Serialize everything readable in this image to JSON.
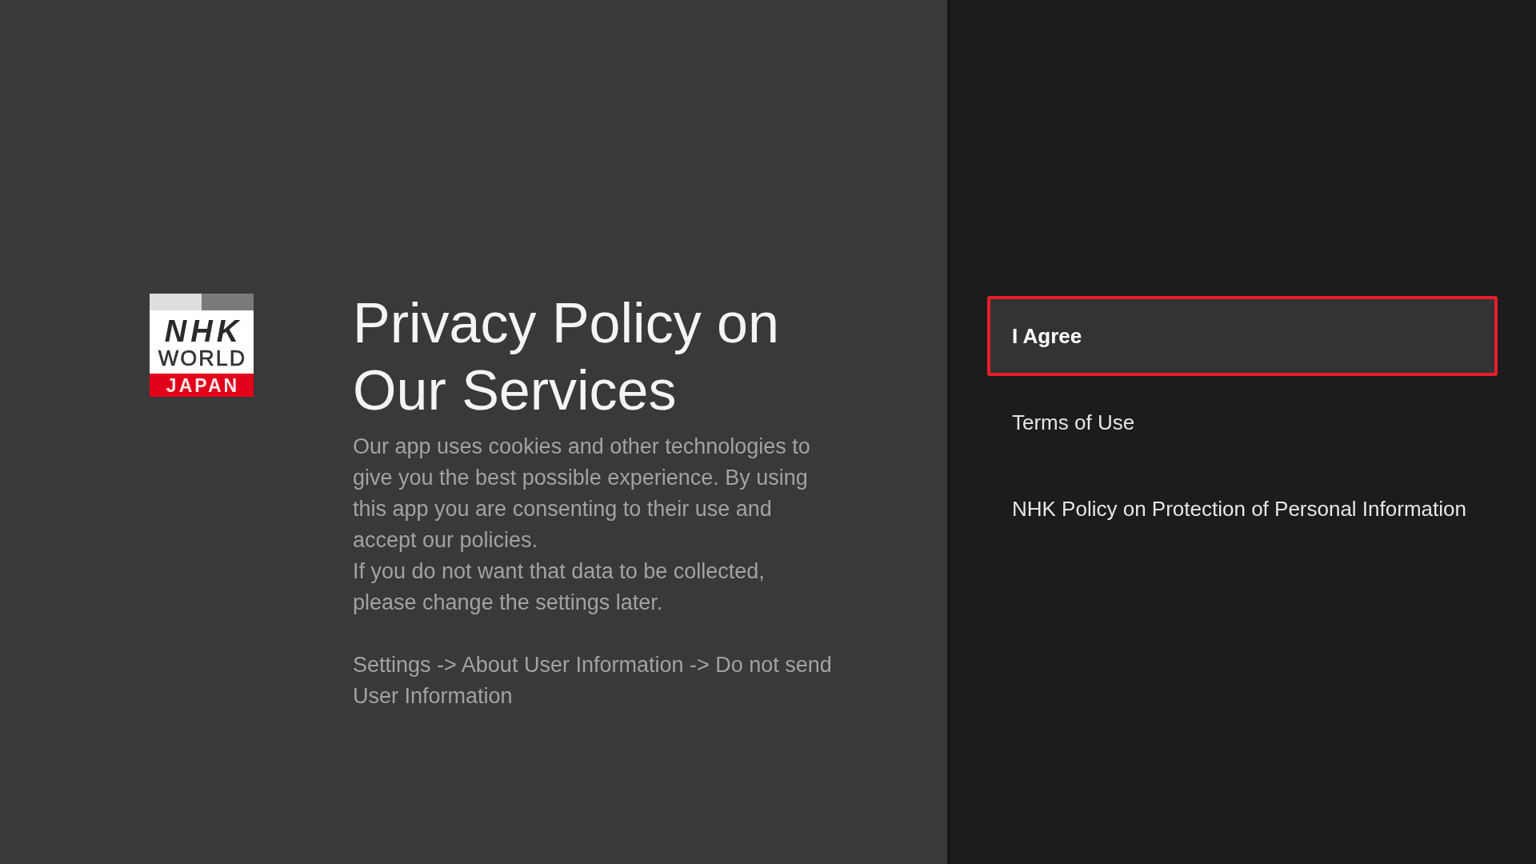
{
  "logo": [
    {
      "kind": "wordmark",
      "text": "NHK"
    },
    {
      "kind": "subline",
      "text": "WORLD"
    },
    {
      "kind": "band",
      "text": "JAPAN"
    }
  ],
  "title": "Privacy Policy on Our Services",
  "body": [
    {
      "kind": "paragraph",
      "text": "Our app uses cookies and other technologies to give you the best possible experience. By using this app you are consenting to their use and accept our policies."
    },
    {
      "kind": "paragraph",
      "text": "If you do not want that data to be collected, please change the settings later."
    },
    {
      "kind": "instruction",
      "text": "Settings -> About User Information -> Do not send User Information"
    }
  ],
  "menu": [
    {
      "label": "I Agree",
      "selected": true
    },
    {
      "label": "Terms of Use",
      "selected": false
    },
    {
      "label": "NHK Policy on Protection of Personal Information",
      "selected": false
    }
  ]
}
